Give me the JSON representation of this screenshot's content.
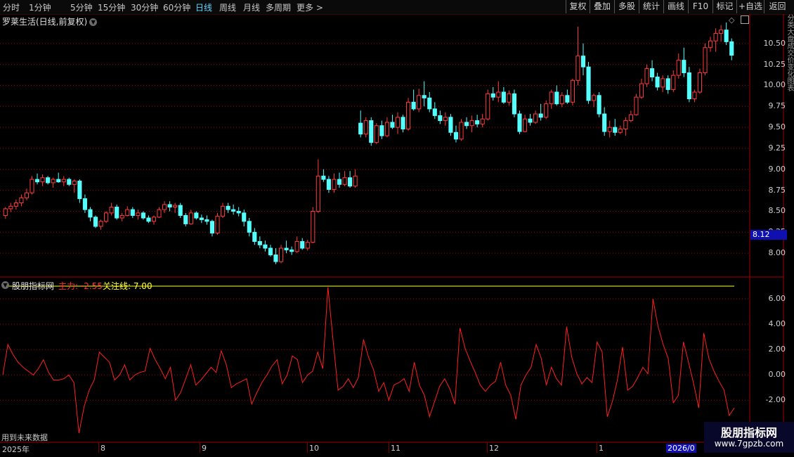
{
  "toolbar": {
    "periods": [
      "分时",
      "1分钟",
      "5分钟",
      "15分钟",
      "30分钟",
      "60分钟",
      "日线",
      "周线",
      "月线",
      "多周期",
      "更多 >"
    ],
    "active_period": "日线",
    "tools": [
      "复权",
      "叠加",
      "多股",
      "统计",
      "画线",
      "F10",
      "标记",
      "+自选",
      "返回"
    ]
  },
  "main": {
    "stock_title": "罗莱生活(日线,前复权)",
    "price_tag": "8.12",
    "y_ticks": [
      "10.50",
      "10.25",
      "10.00",
      "9.75",
      "9.50",
      "9.25",
      "9.00",
      "8.75",
      "8.50",
      "8.25",
      "8.00"
    ],
    "side_text": "分类大盘成交价变化图表"
  },
  "indicator": {
    "name": "股朋指标网",
    "main_label": "主力: -2.55",
    "watch_label": "关注线: 7.00",
    "y_ticks": [
      "6.00",
      "4.00",
      "2.00",
      "0.00",
      "-2.00"
    ],
    "note": "用到未来数据"
  },
  "x_axis": {
    "labels": [
      "2025年",
      "8",
      "9",
      "10",
      "11",
      "12",
      "1",
      "2026/0"
    ]
  },
  "watermark": {
    "title": "股朋指标网",
    "url": "www.7gpzb.com"
  },
  "colors": {
    "up": "#ff3b3b",
    "down": "#54ffff",
    "indicator": "#ff2020",
    "watch_line": "#ffff30",
    "grid": "#a00000"
  },
  "chart_data": [
    {
      "type": "candlestick",
      "title": "罗莱生活(日线,前复权)",
      "ylim": [
        7.75,
        10.85
      ],
      "x_labels": [
        "2025年",
        "8",
        "9",
        "10",
        "11",
        "12",
        "1",
        "2026/0"
      ],
      "candles": [
        [
          8.45,
          8.55,
          8.41,
          8.53
        ],
        [
          8.53,
          8.6,
          8.49,
          8.56
        ],
        [
          8.56,
          8.64,
          8.52,
          8.6
        ],
        [
          8.6,
          8.7,
          8.56,
          8.66
        ],
        [
          8.66,
          8.77,
          8.63,
          8.72
        ],
        [
          8.72,
          8.92,
          8.7,
          8.88
        ],
        [
          8.88,
          8.95,
          8.82,
          8.85
        ],
        [
          8.85,
          8.94,
          8.8,
          8.9
        ],
        [
          8.9,
          8.92,
          8.82,
          8.84
        ],
        [
          8.84,
          8.9,
          8.78,
          8.88
        ],
        [
          8.88,
          8.96,
          8.84,
          8.85
        ],
        [
          8.85,
          8.92,
          8.8,
          8.88
        ],
        [
          8.88,
          8.9,
          8.8,
          8.82
        ],
        [
          8.82,
          8.88,
          8.72,
          8.86
        ],
        [
          8.86,
          8.88,
          8.6,
          8.65
        ],
        [
          8.65,
          8.7,
          8.48,
          8.52
        ],
        [
          8.52,
          8.55,
          8.38,
          8.43
        ],
        [
          8.43,
          8.45,
          8.3,
          8.32
        ],
        [
          8.32,
          8.4,
          8.28,
          8.38
        ],
        [
          8.38,
          8.5,
          8.36,
          8.48
        ],
        [
          8.48,
          8.6,
          8.45,
          8.55
        ],
        [
          8.55,
          8.58,
          8.4,
          8.42
        ],
        [
          8.42,
          8.48,
          8.38,
          8.45
        ],
        [
          8.45,
          8.56,
          8.44,
          8.52
        ],
        [
          8.52,
          8.55,
          8.42,
          8.45
        ],
        [
          8.45,
          8.52,
          8.4,
          8.48
        ],
        [
          8.48,
          8.5,
          8.4,
          8.42
        ],
        [
          8.42,
          8.45,
          8.36,
          8.38
        ],
        [
          8.38,
          8.45,
          8.34,
          8.43
        ],
        [
          8.43,
          8.55,
          8.42,
          8.52
        ],
        [
          8.52,
          8.62,
          8.48,
          8.58
        ],
        [
          8.58,
          8.62,
          8.5,
          8.55
        ],
        [
          8.55,
          8.6,
          8.48,
          8.57
        ],
        [
          8.57,
          8.6,
          8.42,
          8.45
        ],
        [
          8.45,
          8.48,
          8.32,
          8.35
        ],
        [
          8.35,
          8.52,
          8.34,
          8.48
        ],
        [
          8.48,
          8.5,
          8.4,
          8.42
        ],
        [
          8.42,
          8.46,
          8.36,
          8.4
        ],
        [
          8.4,
          8.45,
          8.34,
          8.38
        ],
        [
          8.38,
          8.4,
          8.2,
          8.24
        ],
        [
          8.24,
          8.48,
          8.22,
          8.44
        ],
        [
          8.44,
          8.6,
          8.42,
          8.56
        ],
        [
          8.56,
          8.6,
          8.48,
          8.52
        ],
        [
          8.52,
          8.58,
          8.46,
          8.5
        ],
        [
          8.5,
          8.55,
          8.44,
          8.48
        ],
        [
          8.48,
          8.52,
          8.32,
          8.38
        ],
        [
          8.38,
          8.42,
          8.2,
          8.25
        ],
        [
          8.25,
          8.3,
          8.1,
          8.14
        ],
        [
          8.14,
          8.2,
          8.06,
          8.1
        ],
        [
          8.1,
          8.15,
          8.02,
          8.06
        ],
        [
          8.06,
          8.1,
          7.96,
          7.98
        ],
        [
          7.98,
          8.06,
          7.87,
          7.9
        ],
        [
          7.9,
          8.1,
          7.88,
          8.06
        ],
        [
          8.06,
          8.15,
          8.0,
          8.04
        ],
        [
          8.04,
          8.08,
          7.98,
          8.02
        ],
        [
          8.02,
          8.2,
          8.0,
          8.14
        ],
        [
          8.14,
          8.18,
          8.04,
          8.06
        ],
        [
          8.06,
          8.16,
          8.03,
          8.13
        ],
        [
          8.13,
          8.55,
          8.12,
          8.5
        ],
        [
          8.5,
          9.12,
          8.48,
          8.92
        ],
        [
          8.92,
          9.0,
          8.85,
          8.88
        ],
        [
          8.88,
          8.92,
          8.72,
          8.76
        ],
        [
          8.76,
          8.95,
          8.72,
          8.88
        ],
        [
          8.88,
          8.96,
          8.78,
          8.82
        ],
        [
          8.82,
          8.98,
          8.8,
          8.9
        ],
        [
          8.9,
          8.98,
          8.78,
          8.8
        ],
        [
          8.8,
          9.0,
          8.78,
          8.92
        ],
        [
          9.55,
          9.7,
          9.38,
          9.42
        ],
        [
          9.42,
          9.62,
          9.38,
          9.58
        ],
        [
          9.58,
          9.62,
          9.28,
          9.32
        ],
        [
          9.32,
          9.55,
          9.3,
          9.52
        ],
        [
          9.52,
          9.58,
          9.36,
          9.4
        ],
        [
          9.4,
          9.62,
          9.38,
          9.56
        ],
        [
          9.56,
          9.65,
          9.48,
          9.5
        ],
        [
          9.5,
          9.68,
          9.42,
          9.62
        ],
        [
          9.62,
          9.65,
          9.44,
          9.48
        ],
        [
          9.48,
          9.85,
          9.46,
          9.8
        ],
        [
          9.8,
          9.95,
          9.7,
          9.72
        ],
        [
          9.72,
          9.96,
          9.68,
          9.88
        ],
        [
          9.88,
          10.05,
          9.75,
          9.85
        ],
        [
          9.85,
          9.92,
          9.68,
          9.72
        ],
        [
          9.72,
          9.8,
          9.6,
          9.64
        ],
        [
          9.64,
          9.7,
          9.54,
          9.58
        ],
        [
          9.58,
          9.68,
          9.52,
          9.62
        ],
        [
          9.62,
          9.66,
          9.4,
          9.44
        ],
        [
          9.44,
          9.52,
          9.32,
          9.36
        ],
        [
          9.36,
          9.6,
          9.34,
          9.56
        ],
        [
          9.56,
          9.62,
          9.48,
          9.52
        ],
        [
          9.52,
          9.64,
          9.44,
          9.58
        ],
        [
          9.58,
          9.65,
          9.5,
          9.54
        ],
        [
          9.54,
          9.66,
          9.5,
          9.6
        ],
        [
          9.6,
          9.95,
          9.58,
          9.9
        ],
        [
          9.9,
          9.98,
          9.82,
          9.86
        ],
        [
          9.86,
          10.05,
          9.8,
          9.92
        ],
        [
          9.92,
          9.98,
          9.78,
          9.8
        ],
        [
          9.8,
          9.94,
          9.76,
          9.9
        ],
        [
          9.9,
          9.95,
          9.62,
          9.66
        ],
        [
          9.66,
          9.7,
          9.42,
          9.45
        ],
        [
          9.45,
          9.65,
          9.44,
          9.6
        ],
        [
          9.6,
          9.66,
          9.52,
          9.56
        ],
        [
          9.56,
          9.7,
          9.54,
          9.66
        ],
        [
          9.66,
          9.78,
          9.58,
          9.62
        ],
        [
          9.62,
          9.82,
          9.6,
          9.78
        ],
        [
          9.78,
          9.95,
          9.72,
          9.92
        ],
        [
          9.92,
          10.0,
          9.76,
          9.78
        ],
        [
          9.78,
          9.92,
          9.74,
          9.88
        ],
        [
          9.88,
          9.95,
          9.78,
          9.8
        ],
        [
          9.8,
          10.08,
          9.76,
          10.06
        ],
        [
          10.06,
          10.7,
          10.0,
          10.35
        ],
        [
          10.35,
          10.5,
          10.12,
          10.22
        ],
        [
          10.22,
          10.28,
          9.78,
          9.82
        ],
        [
          9.82,
          9.9,
          9.74,
          9.88
        ],
        [
          9.88,
          9.92,
          9.62,
          9.66
        ],
        [
          9.66,
          9.74,
          9.4,
          9.45
        ],
        [
          9.45,
          9.58,
          9.38,
          9.5
        ],
        [
          9.5,
          9.6,
          9.4,
          9.44
        ],
        [
          9.44,
          9.52,
          9.42,
          9.48
        ],
        [
          9.48,
          9.62,
          9.4,
          9.58
        ],
        [
          9.58,
          9.7,
          9.56,
          9.65
        ],
        [
          9.65,
          9.9,
          9.64,
          9.86
        ],
        [
          9.86,
          10.08,
          9.84,
          10.02
        ],
        [
          10.02,
          10.25,
          9.98,
          10.2
        ],
        [
          10.2,
          10.3,
          10.05,
          10.1
        ],
        [
          10.1,
          10.15,
          9.94,
          9.98
        ],
        [
          9.98,
          10.12,
          9.92,
          10.08
        ],
        [
          10.08,
          10.12,
          9.9,
          9.95
        ],
        [
          9.95,
          10.18,
          9.92,
          10.12
        ],
        [
          10.12,
          10.38,
          10.08,
          10.3
        ],
        [
          10.3,
          10.45,
          10.1,
          10.15
        ],
        [
          10.15,
          10.22,
          9.8,
          9.84
        ],
        [
          9.84,
          9.95,
          9.8,
          9.92
        ],
        [
          9.92,
          10.2,
          9.9,
          10.15
        ],
        [
          10.15,
          10.5,
          10.12,
          10.45
        ],
        [
          10.45,
          10.58,
          10.4,
          10.53
        ],
        [
          10.53,
          10.68,
          10.4,
          10.62
        ],
        [
          10.62,
          10.72,
          10.52,
          10.66
        ],
        [
          10.66,
          10.75,
          10.48,
          10.52
        ],
        [
          10.52,
          10.56,
          10.3,
          10.36
        ]
      ]
    },
    {
      "type": "line",
      "title": "股朋指标网",
      "ylim": [
        -3.7,
        7.5
      ],
      "yticks": [
        6,
        4,
        2,
        0,
        -2
      ],
      "series": [
        {
          "name": "主力",
          "values": [
            0.0,
            2.4,
            1.6,
            1.0,
            0.6,
            0.3,
            0.0,
            0.5,
            1.2,
            0.2,
            -0.4,
            -0.4,
            -0.3,
            0.0,
            -0.6,
            -4.6,
            -2.5,
            -1.2,
            -0.4,
            1.8,
            1.4,
            1.0,
            -0.4,
            0.0,
            0.8,
            -0.4,
            0.0,
            0.2,
            0.3,
            2.1,
            1.2,
            0.5,
            -0.3,
            0.6,
            -2.0,
            -1.4,
            -0.3,
            0.8,
            -0.8,
            -0.4,
            0.1,
            0.6,
            0.2,
            1.9,
            0.8,
            -1.0,
            -0.7,
            -0.5,
            -0.3,
            -2.3,
            -1.4,
            -0.6,
            0.0,
            0.7,
            1.2,
            -0.7,
            0.0,
            1.5,
            1.2,
            -0.6,
            0.0,
            0.3,
            1.8,
            0.5,
            6.9,
            2.8,
            -1.2,
            -0.9,
            -0.3,
            -1.0,
            -0.2,
            2.8,
            1.4,
            0.4,
            -1.3,
            -0.6,
            -2.0,
            -0.8,
            -0.6,
            -0.3,
            -1.3,
            1.0,
            -0.8,
            -1.6,
            -3.3,
            -2.1,
            -0.9,
            -0.3,
            -1.1,
            -2.3,
            3.7,
            2.1,
            1.1,
            0.2,
            -0.8,
            -1.3,
            -0.8,
            -0.5,
            1.0,
            -0.8,
            -1.6,
            -3.5,
            -0.8,
            0.0,
            0.6,
            2.4,
            1.3,
            -0.8,
            0.6,
            -0.3,
            -0.8,
            3.8,
            1.4,
            0.1,
            -0.7,
            -0.2,
            -0.6,
            2.6,
            1.8,
            -3.3,
            -2.1,
            -0.4,
            2.2,
            -1.2,
            -0.9,
            -0.2,
            0.6,
            0.1,
            6.0,
            3.8,
            2.4,
            1.3,
            -2.2,
            -1.6,
            2.6,
            1.0,
            -0.7,
            -2.6,
            3.3,
            1.3,
            0.3,
            -0.5,
            -1.2,
            -3.2,
            -2.6
          ]
        },
        {
          "name": "关注线",
          "values": [
            7.0
          ]
        }
      ]
    }
  ]
}
